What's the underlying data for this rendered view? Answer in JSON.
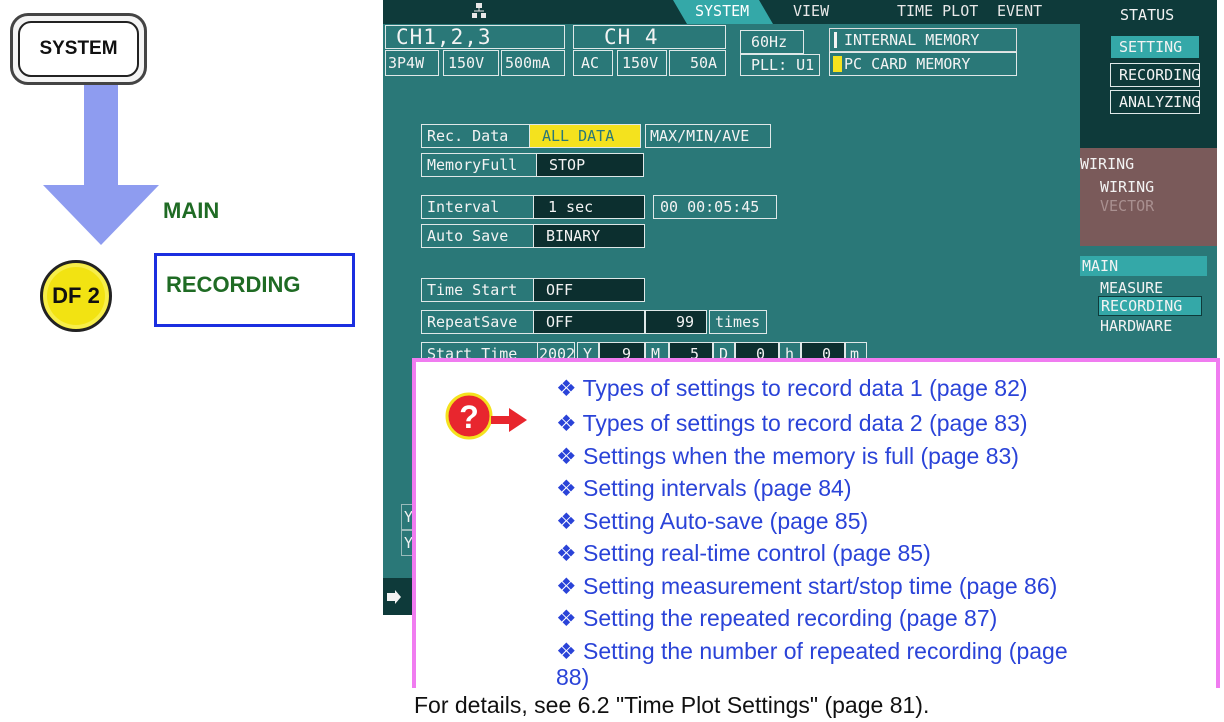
{
  "left": {
    "system_button": "SYSTEM",
    "main_label": "MAIN",
    "df2_label": "DF 2",
    "recording_label": "RECORDING"
  },
  "screen": {
    "tabs": [
      "SYSTEM",
      "VIEW",
      "TIME PLOT",
      "EVENT"
    ],
    "ch123": {
      "title": "CH1,2,3",
      "wiring": "3P4W",
      "voltage": "150V",
      "current": "500mA"
    },
    "ch4": {
      "title": "CH 4",
      "mode": "AC",
      "voltage": "150V",
      "current": "50A"
    },
    "freq": "60Hz",
    "pll": "PLL: U1",
    "memory": {
      "internal": "INTERNAL MEMORY",
      "card": "PC CARD  MEMORY"
    },
    "right_menu": {
      "status": "STATUS",
      "setting": "SETTING",
      "recording": "RECORDING",
      "analyzing": "ANALYZING",
      "wiring_header": "WIRING",
      "wiring": "WIRING",
      "vector": "VECTOR",
      "main_header": "MAIN",
      "measure": "MEASURE",
      "recording2": "RECORDING",
      "hardware": "HARDWARE"
    },
    "fields": {
      "rec_data_label": "Rec. Data",
      "rec_data_sel": "ALL DATA",
      "rec_data_alt": "MAX/MIN/AVE",
      "memfull_label": "MemoryFull",
      "memfull_val": "STOP",
      "interval_label": "Interval",
      "interval_val": "1 sec",
      "interval_time": "00 00:05:45",
      "autosave_label": "Auto Save",
      "autosave_val": "BINARY",
      "timestart_label": "Time Start",
      "timestart_val": "OFF",
      "repeat_label": "RepeatSave",
      "repeat_val": "OFF",
      "repeat_count": "99",
      "repeat_unit": "times",
      "starttime_label": "Start Time",
      "start_year": "2002",
      "y": "Y",
      "start_month": "9",
      "m": "M",
      "start_day": "5",
      "d": "D",
      "start_hour": "0",
      "h": "h",
      "start_min": "0",
      "mm": "m"
    },
    "left_partial": [
      "Y",
      "Y"
    ]
  },
  "popup": {
    "links": [
      "❖ Types of settings to record data 1 (page 82)",
      "❖ Types of settings to record data 2 (page 83)",
      "❖ Settings when the memory is full (page 83)",
      "❖ Setting intervals (page 84)",
      "❖ Setting Auto-save (page 85)",
      "❖ Setting real-time control (page 85)",
      "❖ Setting measurement start/stop time (page 86)",
      "❖ Setting the repeated recording (page 87)",
      "❖ Setting the number of repeated recording (page",
      "88)"
    ]
  },
  "footer": "For details, see 6.2 \"Time Plot Settings\" (page 81)."
}
